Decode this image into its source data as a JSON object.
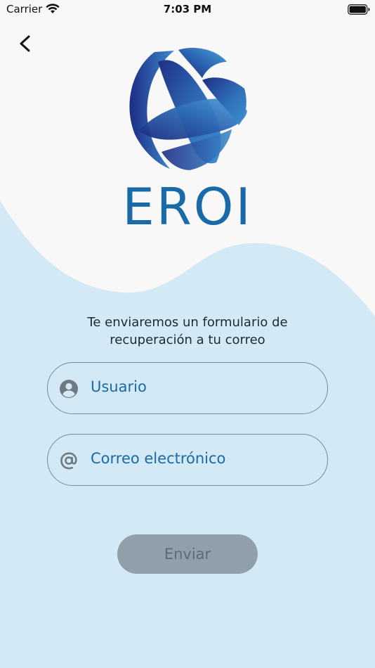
{
  "status_bar": {
    "carrier": "Carrier",
    "time": "7:03 PM"
  },
  "logo": {
    "text": "EROI"
  },
  "form": {
    "subtitle_line1": "Te enviaremos un formulario de",
    "subtitle_line2": "recuperación a tu correo",
    "username_placeholder": "Usuario",
    "email_placeholder": "Correo electrónico",
    "submit_label": "Enviar"
  },
  "colors": {
    "background": "#f8f8f8",
    "wave": "#d3e9f5",
    "brand": "#1a6aa8",
    "button": "#8fa0aa",
    "button_text": "#5d6b74",
    "field_border": "#7a8a95"
  },
  "icons": {
    "back": "chevron-left-icon",
    "user": "account-circle-icon",
    "email": "at-sign-icon",
    "wifi": "wifi-icon",
    "battery": "battery-icon"
  }
}
